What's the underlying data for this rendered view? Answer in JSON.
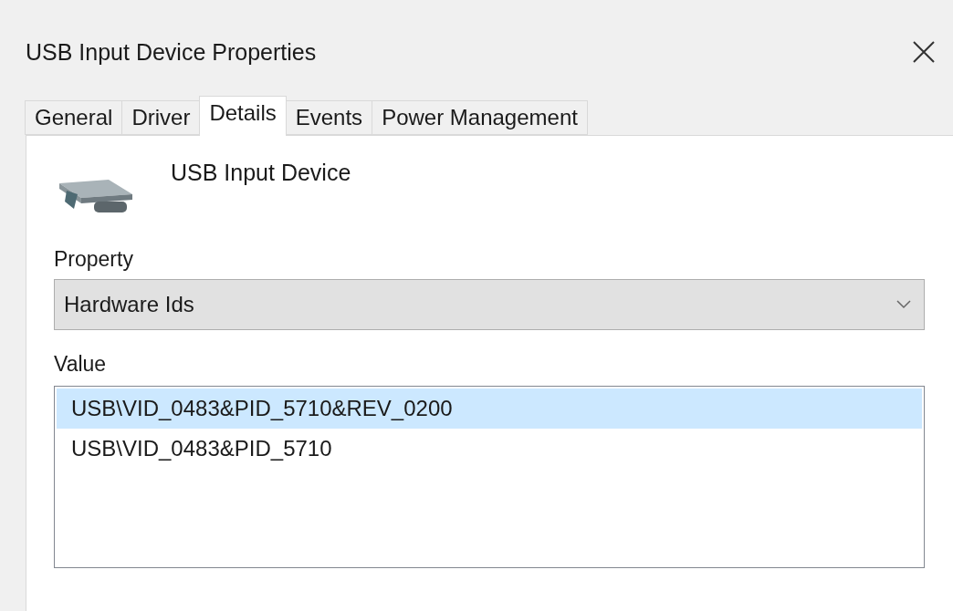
{
  "window": {
    "title": "USB Input Device Properties"
  },
  "tabs": [
    {
      "label": "General",
      "selected": false
    },
    {
      "label": "Driver",
      "selected": false
    },
    {
      "label": "Details",
      "selected": true
    },
    {
      "label": "Events",
      "selected": false
    },
    {
      "label": "Power Management",
      "selected": false
    }
  ],
  "device": {
    "name": "USB Input Device"
  },
  "property": {
    "label": "Property",
    "value": "Hardware Ids"
  },
  "value": {
    "label": "Value",
    "items": [
      {
        "text": "USB\\VID_0483&PID_5710&REV_0200",
        "selected": true
      },
      {
        "text": "USB\\VID_0483&PID_5710",
        "selected": false
      }
    ]
  }
}
